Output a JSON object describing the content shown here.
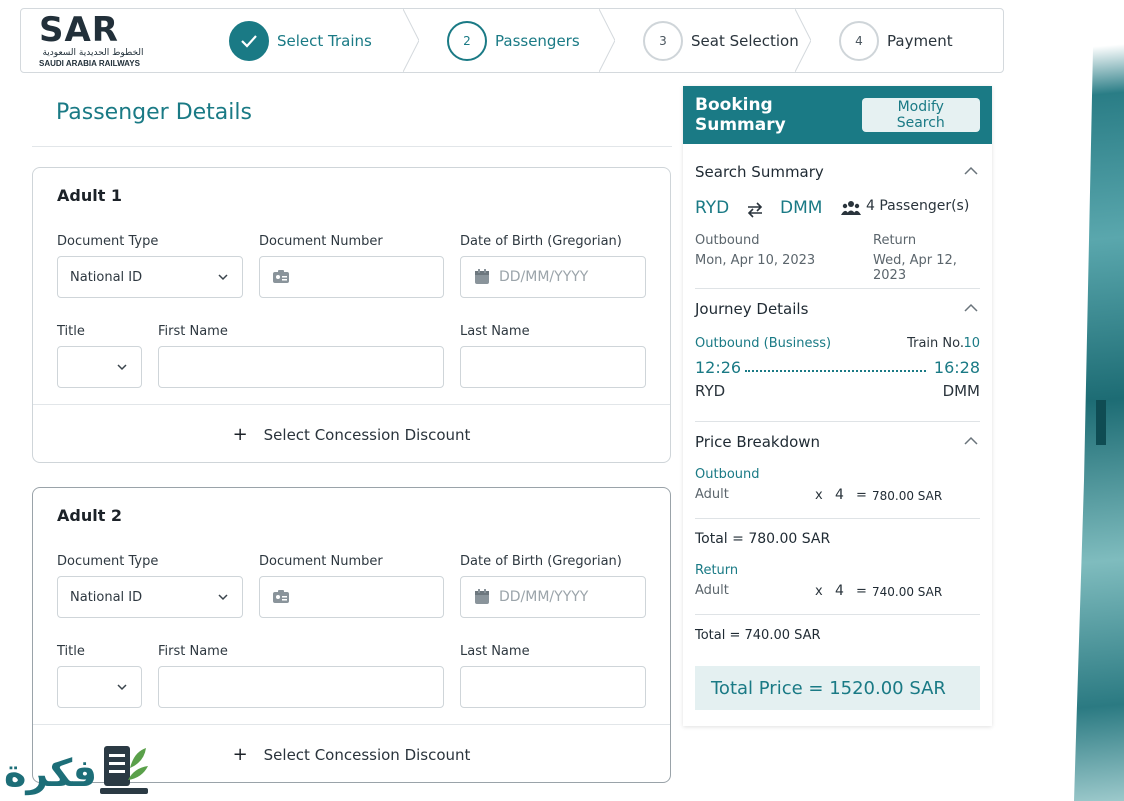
{
  "brand": {
    "logo_mark": "SAR",
    "logo_ar": "الخطوط الحديدية السعودية",
    "logo_en": "SAUDI ARABIA RAILWAYS"
  },
  "stepper": [
    {
      "number": "",
      "label": "Select Trains",
      "state": "done",
      "icon": "check-icon"
    },
    {
      "number": "2",
      "label": "Passengers",
      "state": "active"
    },
    {
      "number": "3",
      "label": "Seat Selection",
      "state": "pending"
    },
    {
      "number": "4",
      "label": "Payment",
      "state": "pending"
    }
  ],
  "page_title": "Passenger Details",
  "passengers": [
    {
      "heading": "Adult 1",
      "document_type_label": "Document Type",
      "document_type_value": "National ID",
      "document_number_label": "Document Number",
      "dob_label": "Date of Birth (Gregorian)",
      "dob_placeholder": "DD/MM/YYYY",
      "title_label": "Title",
      "first_name_label": "First Name",
      "last_name_label": "Last Name",
      "concession_label": "Select Concession Discount"
    },
    {
      "heading": "Adult 2",
      "document_type_label": "Document Type",
      "document_type_value": "National ID",
      "document_number_label": "Document Number",
      "dob_label": "Date of Birth (Gregorian)",
      "dob_placeholder": "DD/MM/YYYY",
      "title_label": "Title",
      "first_name_label": "First Name",
      "last_name_label": "Last Name",
      "concession_label": "Select Concession Discount"
    }
  ],
  "summary": {
    "title": "Booking Summary",
    "modify_label": "Modify Search",
    "search_summary_title": "Search Summary",
    "from": "RYD",
    "to": "DMM",
    "passengers": "4 Passenger(s)",
    "outbound_label": "Outbound",
    "outbound_date": "Mon, Apr 10, 2023",
    "return_label": "Return",
    "return_date": "Wed, Apr 12, 2023",
    "journey_title": "Journey Details",
    "journey_class": "Outbound (Business)",
    "train_label": "Train No.",
    "train_no": "10",
    "depart_time": "12:26",
    "arrive_time": "16:28",
    "depart_station": "RYD",
    "arrive_station": "DMM",
    "price_title": "Price Breakdown",
    "outbound_section": "Outbound",
    "outbound_pax": "Adult",
    "outbound_mult": "x",
    "outbound_qty": "4",
    "outbound_eq": "=",
    "outbound_amount": "780.00 SAR",
    "outbound_total": "Total = 780.00 SAR",
    "return_section": "Return",
    "return_pax": "Adult",
    "return_mult": "x",
    "return_qty": "4",
    "return_eq": "=",
    "return_amount": "740.00 SAR",
    "return_total": "Total = 740.00 SAR",
    "grand_total": "Total Price = 1520.00 SAR"
  },
  "watermark": {
    "text": "فكرة"
  },
  "colors": {
    "accent": "#1a7a85",
    "accent_light": "#e4f0f1",
    "border": "#cfd5d9"
  }
}
